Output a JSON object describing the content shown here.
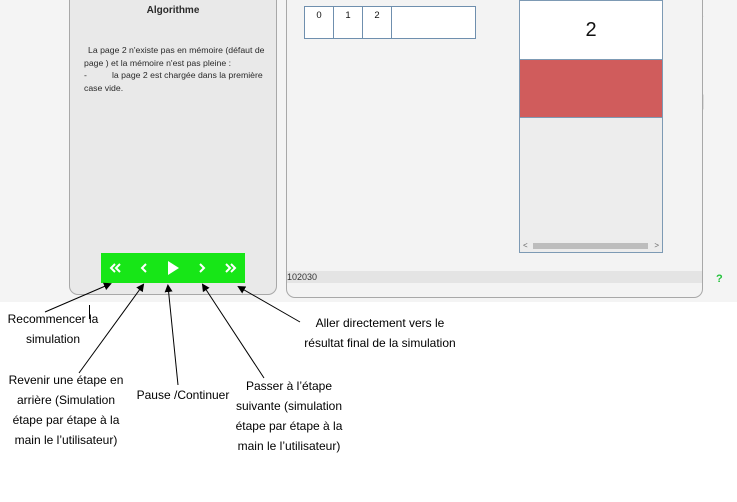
{
  "algorithm": {
    "title": "Algorithme",
    "line1": "La page 2 n'existe pas en mémoire (défaut de page ) et la mémoire n'est pas pleine :",
    "line2_prefix": "-",
    "line2": "la page 2 est chargée dans la première case vide."
  },
  "controls": [
    {
      "name": "restart-button",
      "icon": "double-chevron-left-icon"
    },
    {
      "name": "previous-step-button",
      "icon": "chevron-left-icon"
    },
    {
      "name": "play-pause-button",
      "icon": "play-icon"
    },
    {
      "name": "next-step-button",
      "icon": "chevron-right-icon"
    },
    {
      "name": "go-to-end-button",
      "icon": "double-chevron-right-icon"
    }
  ],
  "page_sequence": {
    "cells": [
      "0",
      "1",
      "2",
      ""
    ]
  },
  "memory": {
    "slot_value": "2",
    "highlight_color": "#d05c5c"
  },
  "status": {
    "sequence": "102030"
  },
  "help": {
    "label": "?"
  },
  "annotations": {
    "restart": "Recommencer la simulation",
    "previous": "Revenir une étape en arrière (Simulation étape par étape à la main le l’utilisateur)",
    "pause": "Pause /Continuer",
    "next": "Passer à l’étape suivante (simulation étape par étape à la main le l’utilisateur)",
    "end": "Aller directement vers le résultat final de la simulation"
  },
  "colors": {
    "controls_bg": "#17e617",
    "help": "#23c23a"
  }
}
